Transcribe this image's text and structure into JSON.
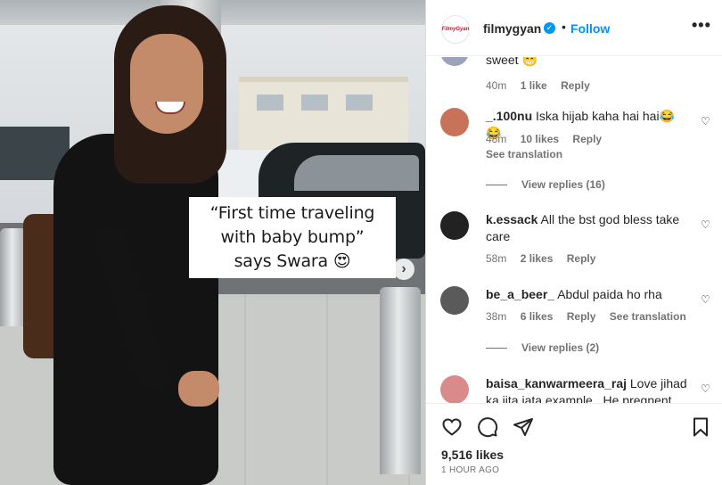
{
  "post": {
    "caption_lines": [
      "“First time traveling",
      "with baby bump”",
      "says Swara 😍"
    ]
  },
  "header": {
    "avatar_text": "FilmyGyan",
    "username": "filmygyan",
    "dot": "•",
    "follow_label": "Follow",
    "more_label": "•••"
  },
  "comments": [
    {
      "username": "",
      "text": "sweet 😁",
      "time": "40m",
      "likes": "1 like",
      "reply": "Reply"
    },
    {
      "username": "_.100nu",
      "text": "Iska hijab kaha hai hai😂😂",
      "time": "48m",
      "likes": "10 likes",
      "reply": "Reply",
      "see_translation": "See translation",
      "view_replies": "View replies (16)"
    },
    {
      "username": "k.essack",
      "text": "All the bst god bless take care",
      "time": "58m",
      "likes": "2 likes",
      "reply": "Reply"
    },
    {
      "username": "be_a_beer_",
      "text": "Abdul paida ho rha",
      "time": "38m",
      "likes": "6 likes",
      "reply": "Reply",
      "see_translation": "See translation",
      "view_replies": "View replies (2)"
    },
    {
      "username": "baisa_kanwarmeera_raj",
      "text": "Love jihad ka jita jata example . He pregnent"
    }
  ],
  "footer": {
    "likes": "9,516 likes",
    "time": "1 HOUR AGO"
  },
  "colors": {
    "accent": "#0095f6",
    "text": "#262626",
    "muted": "#737373"
  }
}
